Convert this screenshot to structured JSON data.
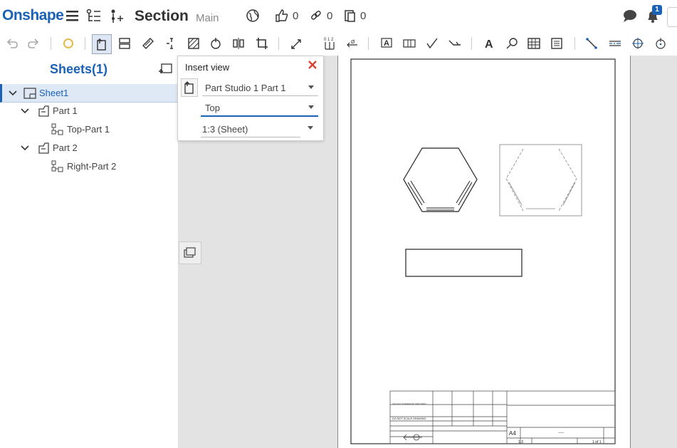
{
  "header": {
    "logo": "Onshape",
    "document_name": "Section",
    "branch": "Main",
    "likes_count": "0",
    "links_count": "0",
    "copies_count": "0",
    "notification_count": "1"
  },
  "left_panel": {
    "title": "Sheets(1)",
    "tree": [
      {
        "label": "Sheet1",
        "level": 0,
        "selected": true
      },
      {
        "label": "Part 1",
        "level": 1
      },
      {
        "label": "Top-Part 1",
        "level": 2
      },
      {
        "label": "Part 2",
        "level": 1
      },
      {
        "label": "Right-Part 2",
        "level": 2
      }
    ]
  },
  "insert_view": {
    "title": "Insert view",
    "part_select": "Part Studio 1 Part 1",
    "orientation_select": "Top",
    "scale_select": "1:3 (Sheet)"
  },
  "title_block": {
    "sheet_size": "A4",
    "scale": "1:3",
    "sheet_of": "1 of 1",
    "do_not_scale": "DO NOT SCALE DRAWING",
    "dashes": "-----"
  },
  "colors": {
    "brand_blue": "#1a62b5",
    "canvas_gray": "#e3e3e3",
    "close_red": "#d8412f",
    "notification_blue": "#1a62b5"
  },
  "icons": [
    "hamburger-icon",
    "feature-list-icon",
    "insert-icon",
    "globe-icon",
    "thumbs-up-icon",
    "link-icon",
    "copy-icon",
    "comment-icon",
    "bell-icon"
  ]
}
